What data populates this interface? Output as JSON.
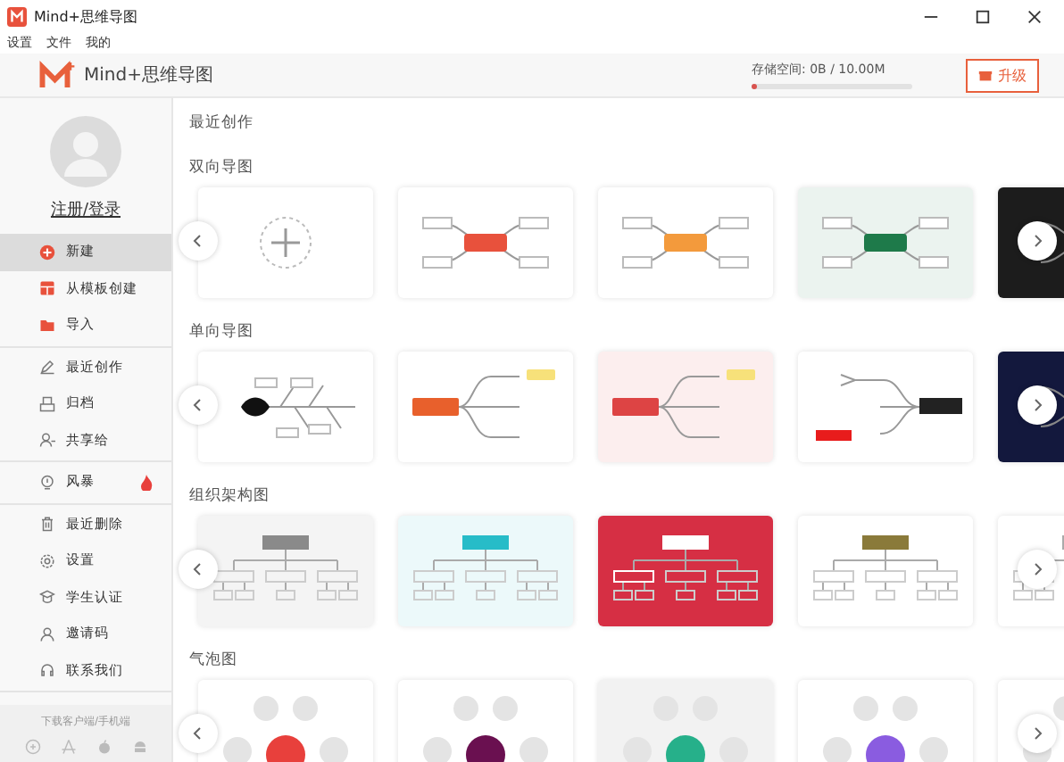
{
  "window": {
    "title": "Mind+思维导图"
  },
  "menu": [
    "设置",
    "文件",
    "我的"
  ],
  "header": {
    "app_name": "Mind+思维导图",
    "storage_label": "存储空间: 0B / 10.00M",
    "storage": {
      "level": 0.02
    },
    "upgrade": "升级"
  },
  "sidebar": {
    "login": "注册/登录",
    "groups": [
      [
        {
          "label": "新建",
          "selected": true
        },
        {
          "label": "从模板创建",
          "selected": false
        },
        {
          "label": "导入",
          "selected": false
        }
      ],
      [
        {
          "label": "最近创作",
          "selected": false
        },
        {
          "label": "归档",
          "selected": false
        },
        {
          "label": "共享给",
          "selected": false
        }
      ],
      [
        {
          "label": "风暴",
          "selected": false,
          "hot": true
        }
      ],
      [
        {
          "label": "最近删除",
          "selected": false
        },
        {
          "label": "设置",
          "selected": false
        },
        {
          "label": "学生认证",
          "selected": false
        },
        {
          "label": "邀请码",
          "selected": false
        },
        {
          "label": "联系我们",
          "selected": false
        }
      ]
    ],
    "footer": "下载客户端/手机端"
  },
  "main": {
    "title": "最近创作",
    "sections": [
      {
        "title": "双向导图",
        "cards": [
          {
            "kind": "new"
          },
          {
            "kind": "map",
            "color": "#e8513c"
          },
          {
            "kind": "map",
            "color": "#f39a3c"
          },
          {
            "kind": "tintmap",
            "color": "#1e7a4a"
          },
          {
            "kind": "darkmap",
            "color": "#1c1c1c"
          }
        ]
      },
      {
        "title": "单向导图",
        "cards": [
          {
            "kind": "fishbone",
            "color": "#111111"
          },
          {
            "kind": "right",
            "color": "#e8602c"
          },
          {
            "kind": "tintright",
            "color": "#dd4444"
          },
          {
            "kind": "left",
            "color": "#222222"
          },
          {
            "kind": "darkmap",
            "color": "#13183d"
          }
        ]
      },
      {
        "title": "组织架构图",
        "cards": [
          {
            "kind": "tintorg",
            "color": "#8a8a8a"
          },
          {
            "kind": "tintorg",
            "color": "#27bcc8"
          },
          {
            "kind": "solidorg",
            "color": "#d62f44"
          },
          {
            "kind": "org",
            "color": "#8a7a3a"
          },
          {
            "kind": "org"
          }
        ]
      },
      {
        "title": "气泡图",
        "cards": [
          {
            "kind": "bubble",
            "color": "#e8403c"
          },
          {
            "kind": "bubble",
            "color": "#6a1050"
          },
          {
            "kind": "greybubble",
            "color": "#26b08a"
          },
          {
            "kind": "bubble",
            "color": "#8a5ce0"
          },
          {
            "kind": "bubble"
          }
        ]
      }
    ]
  }
}
